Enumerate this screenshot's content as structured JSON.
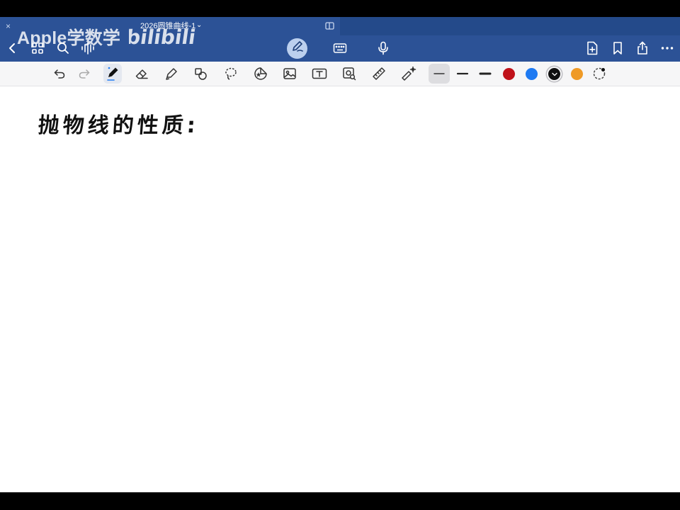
{
  "tab": {
    "close_glyph": "×",
    "title": "2026圆锥曲线-1",
    "chevron": "⌄"
  },
  "watermark": {
    "text": "Apple学数学",
    "logo_text": "bilibili"
  },
  "header_icons": [
    "back-chevron-icon",
    "grid-icon",
    "search-icon",
    "audio-wave-icon",
    "pen-mode-icon",
    "keyboard-icon",
    "microphone-icon",
    "add-page-icon",
    "bookmark-icon",
    "share-icon",
    "more-icon"
  ],
  "toolbar": {
    "tools": [
      "undo-icon",
      "redo-icon",
      "pen-icon",
      "eraser-icon",
      "highlighter-icon",
      "shapes-icon",
      "lasso-icon",
      "sticker-icon",
      "image-icon",
      "text-box-icon",
      "camera-icon",
      "ruler-icon",
      "laser-pointer-icon"
    ],
    "stroke_widths": [
      "thin",
      "medium",
      "thick"
    ],
    "colors": [
      "#c0121a",
      "#1e7af2",
      "#111111",
      "#ef9a26"
    ]
  },
  "page": {
    "handwritten_text": "抛物线的性质:"
  },
  "colors": {
    "header_blue": "#2c5296",
    "toolbar_bg": "#f6f6f7",
    "page_bg": "#ffffff"
  }
}
